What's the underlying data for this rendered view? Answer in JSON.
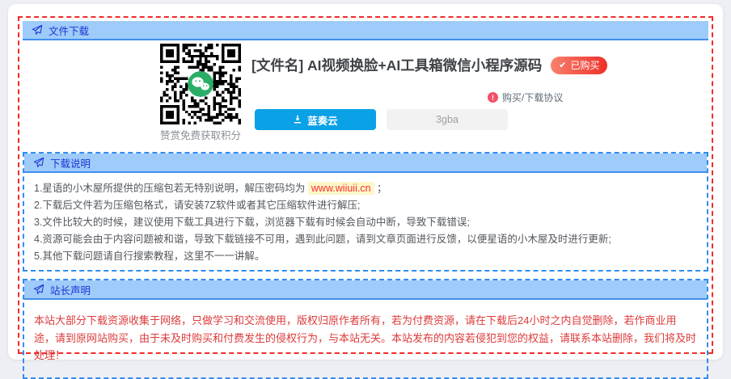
{
  "sections": {
    "file_download": {
      "header": "文件下载",
      "qr_caption": "赞赏免费获取积分",
      "file_title": "[文件名] AI视频换脸+AI工具箱微信小程序源码",
      "purchased_badge": "已购买",
      "badge_check": "✔",
      "agreement_link": "购买/下载协议",
      "agreement_mark": "!",
      "download_buttons": [
        {
          "label": "蓝奏云",
          "style": "primary"
        },
        {
          "label": "3gba",
          "style": "default"
        }
      ]
    },
    "download_notes": {
      "header": "下载说明",
      "items": [
        {
          "prefix": "1.星语的小木屋所提供的压缩包若无特别说明，解压密码均为 ",
          "highlight": "www.wiiuii.cn",
          "suffix": " ；"
        },
        "2.下载后文件若为压缩包格式，请安装7Z软件或者其它压缩软件进行解压;",
        "3.文件比较大的时候，建议使用下载工具进行下载，浏览器下载有时候会自动中断，导致下载错误;",
        "4.资源可能会由于内容问题被和谐，导致下载链接不可用，遇到此问题，请到文章页面进行反馈，以便星语的小木屋及时进行更新;",
        "5.其他下载问题请自行搜索教程，这里不一一讲解。"
      ]
    },
    "webmaster_statement": {
      "header": "站长声明",
      "text": "本站大部分下载资源收集于网络，只做学习和交流使用，版权归原作者所有，若为付费资源，请在下载后24小时之内自觉删除，若作商业用途，请到原网站购买，由于未及时购买和付费发生的侵权行为，与本站无关。本站发布的内容若侵犯到您的权益，请联系本站删除，我们将及时处理！"
    }
  },
  "colors": {
    "panel_header_bg": "#9ecbfa",
    "panel_header_text": "#1d33d3",
    "panel_header_border": "#418ff0",
    "outer_dashed_border": "#f12b2b",
    "section_dashed_border": "#2f8df2",
    "primary_button": "#0aa1e6",
    "badge_gradient_start": "#f9816f",
    "badge_gradient_end": "#ee3028",
    "highlight_bg": "#fcf7c8",
    "highlight_text": "#ff2f2f",
    "statement_text": "#dd3a3a",
    "wechat_green": "#2aae67"
  }
}
